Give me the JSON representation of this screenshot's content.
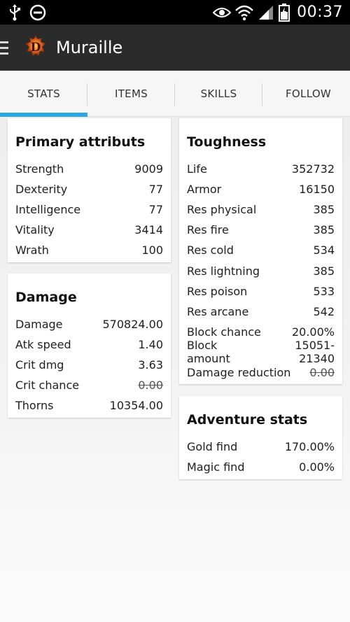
{
  "status_bar": {
    "time": "00:37",
    "icons": [
      "usb-icon",
      "dnd-icon",
      "eye-icon",
      "wifi-icon",
      "signal-icon",
      "battery-icon"
    ]
  },
  "app_bar": {
    "title": "Muraille",
    "logo_letter": "D"
  },
  "tabs": [
    {
      "label": "STATS",
      "active": true
    },
    {
      "label": "ITEMS",
      "active": false
    },
    {
      "label": "SKILLS",
      "active": false
    },
    {
      "label": "FOLLOW",
      "active": false
    }
  ],
  "colors": {
    "accent": "#2aa8e6",
    "app_bar": "#2b2b2b",
    "status_bar": "#000000"
  },
  "primary": {
    "title": "Primary attributs",
    "rows": [
      {
        "label": "Strength",
        "value": "9009"
      },
      {
        "label": "Dexterity",
        "value": "77"
      },
      {
        "label": "Intelligence",
        "value": "77"
      },
      {
        "label": "Vitality",
        "value": "3414"
      },
      {
        "label": "Wrath",
        "value": "100"
      }
    ]
  },
  "damage": {
    "title": "Damage",
    "rows": [
      {
        "label": "Damage",
        "value": "570824.00"
      },
      {
        "label": "Atk speed",
        "value": "1.40"
      },
      {
        "label": "Crit dmg",
        "value": "3.63"
      },
      {
        "label": "Crit chance",
        "value": "0.00"
      },
      {
        "label": "Thorns",
        "value": "10354.00"
      }
    ]
  },
  "toughness": {
    "title": "Toughness",
    "rows": [
      {
        "label": "Life",
        "value": "352732"
      },
      {
        "label": "Armor",
        "value": "16150"
      },
      {
        "label": "Res physical",
        "value": "385"
      },
      {
        "label": "Res fire",
        "value": "385"
      },
      {
        "label": "Res cold",
        "value": "534"
      },
      {
        "label": "Res lightning",
        "value": "385"
      },
      {
        "label": "Res poison",
        "value": "533"
      },
      {
        "label": "Res arcane",
        "value": "542"
      },
      {
        "label": "Block chance",
        "value": "20.00%"
      },
      {
        "label": "Block amount",
        "value": "15051-21340"
      },
      {
        "label": "Damage reduction",
        "value": "0.00"
      }
    ]
  },
  "adventure": {
    "title": "Adventure stats",
    "rows": [
      {
        "label": "Gold find",
        "value": "170.00%"
      },
      {
        "label": "Magic find",
        "value": "0.00%"
      }
    ]
  }
}
